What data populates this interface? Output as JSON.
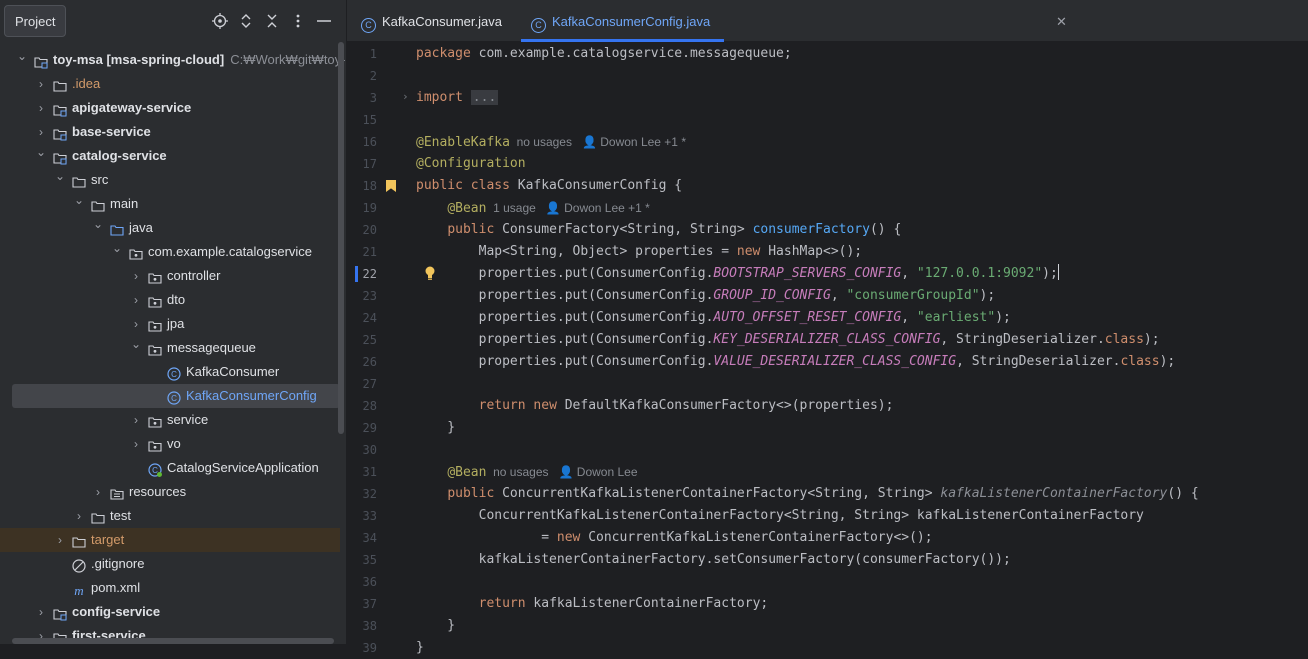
{
  "sidebar": {
    "title": "Project",
    "tree": [
      {
        "label": "toy-msa [msa-spring-cloud]",
        "path": "C:₩Work₩git₩toy-msa",
        "depth": 0,
        "chevron": "down",
        "icon": "module-folder",
        "bold": true
      },
      {
        "label": ".idea",
        "depth": 1,
        "chevron": "right",
        "icon": "folder",
        "color": "orange"
      },
      {
        "label": "apigateway-service",
        "depth": 1,
        "chevron": "right",
        "icon": "module-folder",
        "bold": true
      },
      {
        "label": "base-service",
        "depth": 1,
        "chevron": "right",
        "icon": "module-folder",
        "bold": true
      },
      {
        "label": "catalog-service",
        "depth": 1,
        "chevron": "down",
        "icon": "module-folder",
        "bold": true
      },
      {
        "label": "src",
        "depth": 2,
        "chevron": "down",
        "icon": "folder"
      },
      {
        "label": "main",
        "depth": 3,
        "chevron": "down",
        "icon": "folder"
      },
      {
        "label": "java",
        "depth": 4,
        "chevron": "down",
        "icon": "source-folder"
      },
      {
        "label": "com.example.catalogservice",
        "depth": 5,
        "chevron": "down",
        "icon": "package"
      },
      {
        "label": "controller",
        "depth": 6,
        "chevron": "right",
        "icon": "package"
      },
      {
        "label": "dto",
        "depth": 6,
        "chevron": "right",
        "icon": "package"
      },
      {
        "label": "jpa",
        "depth": 6,
        "chevron": "right",
        "icon": "package"
      },
      {
        "label": "messagequeue",
        "depth": 6,
        "chevron": "down",
        "icon": "package"
      },
      {
        "label": "KafkaConsumer",
        "depth": 7,
        "chevron": "",
        "icon": "class"
      },
      {
        "label": "KafkaConsumerConfig",
        "depth": 7,
        "chevron": "",
        "icon": "class",
        "selected": true
      },
      {
        "label": "service",
        "depth": 6,
        "chevron": "right",
        "icon": "package"
      },
      {
        "label": "vo",
        "depth": 6,
        "chevron": "right",
        "icon": "package"
      },
      {
        "label": "CatalogServiceApplication",
        "depth": 6,
        "chevron": "",
        "icon": "spring-class"
      },
      {
        "label": "resources",
        "depth": 4,
        "chevron": "right",
        "icon": "resources-folder"
      },
      {
        "label": "test",
        "depth": 3,
        "chevron": "right",
        "icon": "folder"
      },
      {
        "label": "target",
        "depth": 2,
        "chevron": "right",
        "icon": "folder",
        "color": "orange",
        "excluded": true
      },
      {
        "label": ".gitignore",
        "depth": 2,
        "chevron": "",
        "icon": "ignore-file"
      },
      {
        "label": "pom.xml",
        "depth": 2,
        "chevron": "",
        "icon": "maven-file"
      },
      {
        "label": "config-service",
        "depth": 1,
        "chevron": "right",
        "icon": "module-folder",
        "bold": true
      },
      {
        "label": "first-service",
        "depth": 1,
        "chevron": "right",
        "icon": "module-folder",
        "bold": true
      }
    ]
  },
  "tabs": [
    {
      "label": "KafkaConsumer.java",
      "active": false
    },
    {
      "label": "KafkaConsumerConfig.java",
      "active": true
    }
  ],
  "editor": {
    "current_line": "22",
    "lines": [
      {
        "n": "1",
        "tokens": [
          {
            "t": "package ",
            "c": "kw"
          },
          {
            "t": "com.example.catalogservice.messagequeue;"
          }
        ]
      },
      {
        "n": "2",
        "tokens": []
      },
      {
        "n": "3",
        "tokens": [
          {
            "t": "import ",
            "c": "kw"
          },
          {
            "t": "...",
            "c": "fold"
          }
        ]
      },
      {
        "n": "15",
        "tokens": []
      },
      {
        "n": "16",
        "tokens": [
          {
            "t": "@EnableKafka",
            "c": "ann"
          },
          {
            "t": "  no usages   ",
            "c": "hint"
          },
          {
            "t": "👤",
            "c": "hint"
          },
          {
            "t": " Dowon Lee +1 *",
            "c": "hint"
          }
        ]
      },
      {
        "n": "17",
        "tokens": [
          {
            "t": "@Configuration",
            "c": "ann"
          }
        ]
      },
      {
        "n": "18",
        "tokens": [
          {
            "t": "public class ",
            "c": "kw"
          },
          {
            "t": "KafkaConsumerConfig {"
          }
        ]
      },
      {
        "n": "19",
        "tokens": [
          {
            "t": "    "
          },
          {
            "t": "@Bean",
            "c": "ann"
          },
          {
            "t": "  1 usage   ",
            "c": "hint"
          },
          {
            "t": "👤",
            "c": "hint"
          },
          {
            "t": " Dowon Lee +1 *",
            "c": "hint"
          }
        ]
      },
      {
        "n": "20",
        "tokens": [
          {
            "t": "    "
          },
          {
            "t": "public ",
            "c": "kw"
          },
          {
            "t": "ConsumerFactory<String, String> "
          },
          {
            "t": "consumerFactory",
            "c": "fn"
          },
          {
            "t": "() {"
          }
        ]
      },
      {
        "n": "21",
        "tokens": [
          {
            "t": "        Map<String, Object> properties = "
          },
          {
            "t": "new ",
            "c": "kw"
          },
          {
            "t": "HashMap<>();"
          }
        ]
      },
      {
        "n": "22",
        "tokens": [
          {
            "t": "        properties.put(ConsumerConfig."
          },
          {
            "t": "BOOTSTRAP_SERVERS_CONFIG",
            "c": "const"
          },
          {
            "t": ", "
          },
          {
            "t": "\"127.0.0.1:9092\"",
            "c": "str"
          },
          {
            "t": ");"
          },
          {
            "t": "",
            "c": "caret"
          }
        ]
      },
      {
        "n": "23",
        "tokens": [
          {
            "t": "        properties.put(ConsumerConfig."
          },
          {
            "t": "GROUP_ID_CONFIG",
            "c": "const"
          },
          {
            "t": ", "
          },
          {
            "t": "\"consumerGroupId\"",
            "c": "str"
          },
          {
            "t": ");"
          }
        ]
      },
      {
        "n": "24",
        "tokens": [
          {
            "t": "        properties.put(ConsumerConfig."
          },
          {
            "t": "AUTO_OFFSET_RESET_CONFIG",
            "c": "const"
          },
          {
            "t": ", "
          },
          {
            "t": "\"earliest\"",
            "c": "str"
          },
          {
            "t": ");"
          }
        ]
      },
      {
        "n": "25",
        "tokens": [
          {
            "t": "        properties.put(ConsumerConfig."
          },
          {
            "t": "KEY_DESERIALIZER_CLASS_CONFIG",
            "c": "const"
          },
          {
            "t": ", StringDeserializer."
          },
          {
            "t": "class",
            "c": "kw"
          },
          {
            "t": ");"
          }
        ]
      },
      {
        "n": "26",
        "tokens": [
          {
            "t": "        properties.put(ConsumerConfig."
          },
          {
            "t": "VALUE_DESERIALIZER_CLASS_CONFIG",
            "c": "const"
          },
          {
            "t": ", StringDeserializer."
          },
          {
            "t": "class",
            "c": "kw"
          },
          {
            "t": ");"
          }
        ]
      },
      {
        "n": "27",
        "tokens": []
      },
      {
        "n": "28",
        "tokens": [
          {
            "t": "        "
          },
          {
            "t": "return new ",
            "c": "kw"
          },
          {
            "t": "DefaultKafkaConsumerFactory<>(properties);"
          }
        ]
      },
      {
        "n": "29",
        "tokens": [
          {
            "t": "    }"
          }
        ]
      },
      {
        "n": "30",
        "tokens": []
      },
      {
        "n": "31",
        "tokens": [
          {
            "t": "    "
          },
          {
            "t": "@Bean",
            "c": "ann"
          },
          {
            "t": "  no usages   ",
            "c": "hint"
          },
          {
            "t": "👤",
            "c": "hint"
          },
          {
            "t": " Dowon Lee",
            "c": "hint"
          }
        ]
      },
      {
        "n": "32",
        "tokens": [
          {
            "t": "    "
          },
          {
            "t": "public ",
            "c": "kw"
          },
          {
            "t": "ConcurrentKafkaListenerContainerFactory<String, String> "
          },
          {
            "t": "kafkaListenerContainerFactory",
            "c": "mut"
          },
          {
            "t": "() {"
          }
        ]
      },
      {
        "n": "33",
        "tokens": [
          {
            "t": "        ConcurrentKafkaListenerContainerFactory<String, String> kafkaListenerContainerFactory"
          }
        ]
      },
      {
        "n": "34",
        "tokens": [
          {
            "t": "                = "
          },
          {
            "t": "new ",
            "c": "kw"
          },
          {
            "t": "ConcurrentKafkaListenerContainerFactory<>();"
          }
        ]
      },
      {
        "n": "35",
        "tokens": [
          {
            "t": "        kafkaListenerContainerFactory.setConsumerFactory(consumerFactory());"
          }
        ]
      },
      {
        "n": "36",
        "tokens": []
      },
      {
        "n": "37",
        "tokens": [
          {
            "t": "        "
          },
          {
            "t": "return ",
            "c": "kw"
          },
          {
            "t": "kafkaListenerContainerFactory;"
          }
        ]
      },
      {
        "n": "38",
        "tokens": [
          {
            "t": "    }"
          }
        ]
      },
      {
        "n": "39",
        "tokens": [
          {
            "t": "}"
          }
        ]
      }
    ]
  },
  "colors": {
    "background": "#1e1f22",
    "panel": "#2b2d30",
    "accent": "#3574f0",
    "keyword": "#cf8e6d",
    "annotation": "#b3ae60",
    "string": "#6aab73",
    "constant": "#c77dbb",
    "function": "#56a8f5"
  }
}
